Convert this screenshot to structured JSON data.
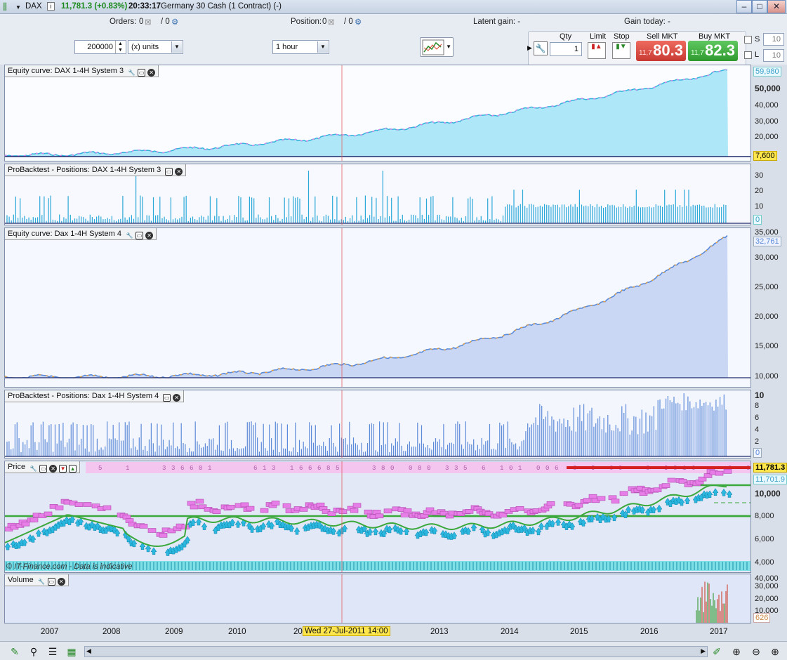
{
  "titlebar": {
    "symbol": "DAX",
    "price_change": "11,781.3 (+0.83%)",
    "time": "20:33:17",
    "description": "Germany 30 Cash (1 Contract) (-)"
  },
  "toolbar": {
    "orders_label": "Orders:",
    "orders_value": "0",
    "orders_slash": "/ 0",
    "position_label": "Position:",
    "position_value": "0",
    "position_slash": "/ 0",
    "latent_gain": "Latent gain: -",
    "gain_today": "Gain today: -",
    "amount": "200000",
    "units": "(x) units",
    "timeframe": "1 hour"
  },
  "trade": {
    "qty_label": "Qty",
    "qty": "1",
    "limit_label": "Limit",
    "stop_label": "Stop",
    "sell_label": "Sell MKT",
    "sell_small": "11,7",
    "sell_big": "80.3",
    "buy_label": "Buy MKT",
    "buy_small": "11,7",
    "buy_big": "82.3",
    "s_label": "S",
    "s_value": "10",
    "l_label": "L",
    "l_value": "10"
  },
  "colors": {
    "sell": "#e04848",
    "buy": "#3aa83a",
    "equity3_fill": "#aee8f8",
    "equity4_fill": "#c9d7f5",
    "long_marker": "#36b6e0",
    "short_marker": "#e070e0"
  },
  "panels": {
    "equity3": {
      "title": "Equity curve: DAX 1-4H System 3",
      "ticks": [
        "50,000",
        "40,000",
        "30,000",
        "20,000",
        "10,000"
      ],
      "last": "59,980",
      "baseline": "7,600"
    },
    "positions3": {
      "title": "ProBacktest - Positions: DAX 1-4H System 3",
      "ticks": [
        "30",
        "20",
        "10"
      ],
      "last": "0"
    },
    "equity4": {
      "title": "Equity curve: Dax 1-4H System 4",
      "ticks": [
        "35,000",
        "30,000",
        "25,000",
        "20,000",
        "15,000",
        "10,000"
      ],
      "last": "32,761"
    },
    "positions4": {
      "title": "ProBacktest - Positions: Dax 1-4H System 4",
      "ticks": [
        "10",
        "8",
        "6",
        "4",
        "2"
      ],
      "last": "0"
    },
    "price": {
      "title": "Price",
      "ticks": [
        "10,000",
        "8,000",
        "6,000",
        "4,000"
      ],
      "last": "11,781.3",
      "second": "11,701.9",
      "source": "© IT-Finance.com - Data is indicative"
    },
    "volume": {
      "title": "Volume",
      "ticks": [
        "40,000",
        "30,000",
        "20,000",
        "10,000"
      ],
      "last": "626"
    }
  },
  "xaxis": {
    "years": [
      "2007",
      "2008",
      "2009",
      "2010",
      "20",
      "2013",
      "2014",
      "2015",
      "2016",
      "2017"
    ],
    "cursor": "Wed 27-Jul-2011 14:00"
  }
}
